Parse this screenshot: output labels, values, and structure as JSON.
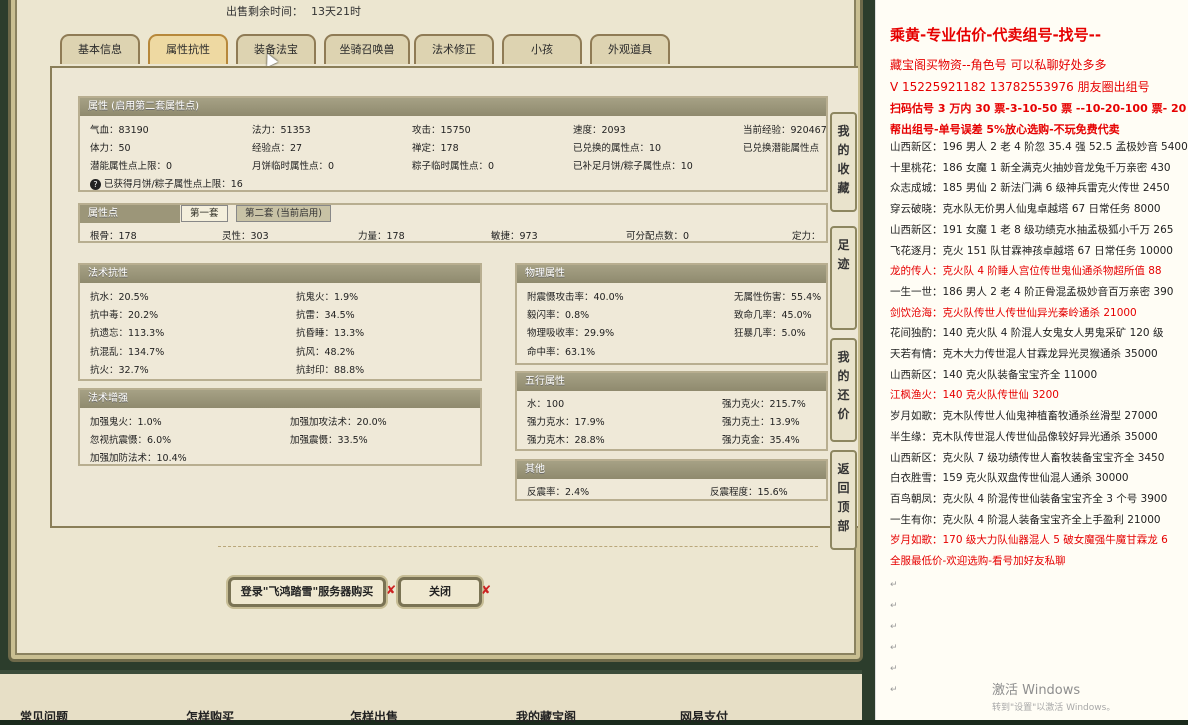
{
  "timer": {
    "label": "出售剩余时间：",
    "value": "13天21时"
  },
  "tabs": [
    "基本信息",
    "属性抗性",
    "装备法宝",
    "坐骑召唤兽",
    "法术修正",
    "小孩",
    "外观道具"
  ],
  "attr": {
    "title": "属性 (启用第二套属性点)",
    "rows": [
      [
        "气血：83190",
        "法力：51353",
        "攻击：15750",
        "速度：2093",
        "当前经验：920467"
      ],
      [
        "体力：50",
        "经验点：27",
        "禅定：178",
        "已兑换的属性点：10",
        "已兑换潜能属性点"
      ],
      [
        "潜能属性点上限：0",
        "月饼临时属性点：0",
        "粽子临时属性点：0",
        "已补足月饼/粽子属性点：10",
        ""
      ]
    ],
    "note": "已获得月饼/粽子属性点上限：16"
  },
  "points": {
    "title": "属性点",
    "tab1": "第一套",
    "tab2": "第二套 (当前启用)",
    "row": [
      "根骨：178",
      "灵性：303",
      "力量：178",
      "敏捷：973",
      "可分配点数：0",
      "定力："
    ]
  },
  "resist": {
    "title": "法术抗性",
    "items": [
      [
        "抗水：20.5%",
        "抗鬼火：1.9%"
      ],
      [
        "抗中毒：20.2%",
        "抗雷：34.5%"
      ],
      [
        "抗遗忘：113.3%",
        "抗昏睡：13.3%"
      ],
      [
        "抗混乱：134.7%",
        "抗风：48.2%"
      ],
      [
        "抗火：32.7%",
        "抗封印：88.8%"
      ]
    ]
  },
  "enhance": {
    "title": "法术增强",
    "items": [
      [
        "加强鬼火：1.0%",
        "加强加攻法术：20.0%"
      ],
      [
        "忽视抗震慑：6.0%",
        "加强震慑：33.5%"
      ],
      [
        "加强加防法术：10.4%",
        ""
      ]
    ]
  },
  "physical": {
    "title": "物理属性",
    "items": [
      [
        "附震慑攻击率：40.0%",
        "无属性伤害：55.4%"
      ],
      [
        "毅闪率：0.8%",
        "致命几率：45.0%"
      ],
      [
        "物理吸收率：29.9%",
        "狂暴几率：5.0%"
      ],
      [
        "命中率：63.1%",
        ""
      ]
    ]
  },
  "wuxing": {
    "title": "五行属性",
    "items": [
      [
        "水：100",
        "强力克火：215.7%"
      ],
      [
        "强力克水：17.9%",
        "强力克土：13.9%"
      ],
      [
        "强力克木：28.8%",
        "强力克金：35.4%"
      ]
    ]
  },
  "other": {
    "title": "其他",
    "items": [
      [
        "反震率：2.4%",
        "反震程度：15.6%"
      ]
    ]
  },
  "side_buttons": [
    "我的收藏",
    "足迹",
    "我的还价",
    "返回顶部"
  ],
  "buttons": {
    "buy": "登录\"飞鸿踏雪\"服务器购买",
    "close": "关闭"
  },
  "footer": [
    "常见问题",
    "怎样购买",
    "怎样出售",
    "我的藏宝阁",
    "网易支付"
  ],
  "right": {
    "title": "乘黄-专业估价-代卖组号-找号--",
    "l2": "藏宝阁买物资--角色号 可以私聊好处多多",
    "l3": "V 15225921182    13782553976 朋友圈出组号",
    "l4": "扫码估号 3 万内 30 票-3-10-50 票 --10-20-100 票- 20 以上",
    "l5": "帮出组号-单号误差 5%放心选购-不玩免费代卖",
    "lines": [
      {
        "t": "山西新区：196 男人 2 老 4 阶忽 35.4 强 52.5 孟极妙音 5400",
        "red": false
      },
      {
        "t": "十里桃花：186 女魔 1 新全满克火抽妙音龙兔千万亲密 430",
        "red": false
      },
      {
        "t": "众志成城：185 男仙 2 新法门满 6 级神兵雷克火传世 2450",
        "red": false
      },
      {
        "t": "穿云破晓：克水队无价男人仙鬼卓越塔 67 日常任务 8000",
        "red": false
      },
      {
        "t": "山西新区：191 女魔 1 老 8 级功绩克水抽孟极狐小千万 265",
        "red": false
      },
      {
        "t": "飞花逐月：克火 151 队甘霖神孩卓越塔 67 日常任务 10000",
        "red": false
      },
      {
        "t": "龙的传人：克火队 4 阶睡人宫位传世鬼仙通杀物超所值 88",
        "red": true
      },
      {
        "t": "一生一世：186 男人 2 老 4 阶正骨混孟极妙音百万亲密 390",
        "red": false
      },
      {
        "t": "剑饮沧海：克火队传世人传世仙异光秦岭通杀 21000",
        "red": true
      },
      {
        "t": "花间独酌：140 克火队 4 阶混人女鬼女人男鬼采矿 120 级",
        "red": false
      },
      {
        "t": "天若有情：克木大力传世混人甘霖龙异光灵猴通杀 35000",
        "red": false
      },
      {
        "t": "山西新区：140 克火队装备宝宝齐全 11000",
        "red": false
      },
      {
        "t": "江枫渔火：140 克火队传世仙 3200",
        "red": true
      },
      {
        "t": "岁月如歌：克木队传世人仙鬼神植畜牧通杀丝滑型 27000",
        "red": false
      },
      {
        "t": "半生缘：克木队传世混人传世仙品像较好异光通杀 35000",
        "red": false
      },
      {
        "t": "山西新区：克火队 7 级功绩传世人畜牧装备宝宝齐全 3450",
        "red": false
      },
      {
        "t": "白衣胜雪：159 克火队双盘传世仙混人通杀 30000",
        "red": false
      },
      {
        "t": "百鸟朝凤：克火队 4 阶混传世仙装备宝宝齐全 3 个号 3900",
        "red": false
      },
      {
        "t": "一生有你：克火队 4 阶混人装备宝宝齐全上手盈利 21000",
        "red": false
      },
      {
        "t": "岁月如歌：170 级大力队仙器混人 5 破女魔强牛魔甘霖龙 6",
        "red": true
      },
      {
        "t": "全服最低价-欢迎选购-看号加好友私聊",
        "red": true
      }
    ],
    "watermark": "激活 Windows",
    "watermark2": "转到\"设置\"以激活 Windows。"
  }
}
